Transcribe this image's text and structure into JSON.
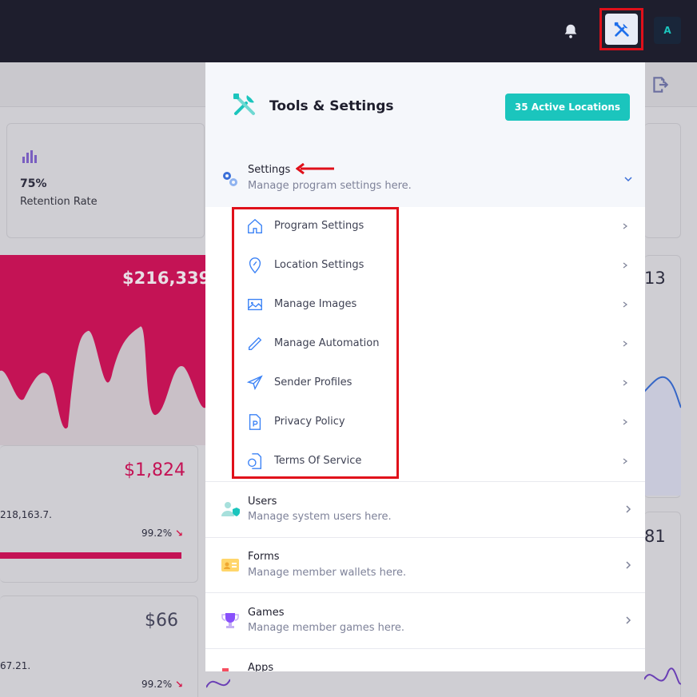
{
  "topbar": {
    "bell_icon": "bell-icon",
    "tools_icon": "tools-icon",
    "avatar_letter": "A"
  },
  "background": {
    "retention_value": "75%",
    "retention_label": "Retention Rate",
    "revenue_amount": "$216,339",
    "amount_1824": "$1,824",
    "amount_small_1": "218,163.7.",
    "pct_1": "99.2%",
    "amount_66": "$66",
    "amount_small_2": "67.21.",
    "pct_2": "99.2%",
    "right_num_1": "13",
    "right_num_2": "81",
    "arrow_down": "↘"
  },
  "panel": {
    "title": "Tools & Settings",
    "active_button": "35 Active Locations",
    "settings": {
      "title": "Settings",
      "subtitle": "Manage program settings here.",
      "items": [
        {
          "label": "Program Settings",
          "icon": "home-icon"
        },
        {
          "label": "Location Settings",
          "icon": "location-pin-icon"
        },
        {
          "label": "Manage Images",
          "icon": "image-icon"
        },
        {
          "label": "Manage Automation",
          "icon": "pen-icon"
        },
        {
          "label": "Sender Profiles",
          "icon": "paper-plane-icon"
        },
        {
          "label": "Privacy Policy",
          "icon": "document-p-icon"
        },
        {
          "label": "Terms Of Service",
          "icon": "document-shield-icon"
        }
      ]
    },
    "sections": [
      {
        "title": "Users",
        "subtitle": "Manage system users here.",
        "icon": "user-shield-icon"
      },
      {
        "title": "Forms",
        "subtitle": "Manage member wallets here.",
        "icon": "id-card-icon"
      },
      {
        "title": "Games",
        "subtitle": "Manage member games here.",
        "icon": "trophy-icon"
      },
      {
        "title": "Apps",
        "subtitle": "",
        "icon": "apps-icon"
      }
    ]
  },
  "colors": {
    "accent_teal": "#1bc5bd",
    "highlight_red": "#e0101a",
    "pink": "#c41355",
    "blue_icon": "#3b82f6"
  }
}
